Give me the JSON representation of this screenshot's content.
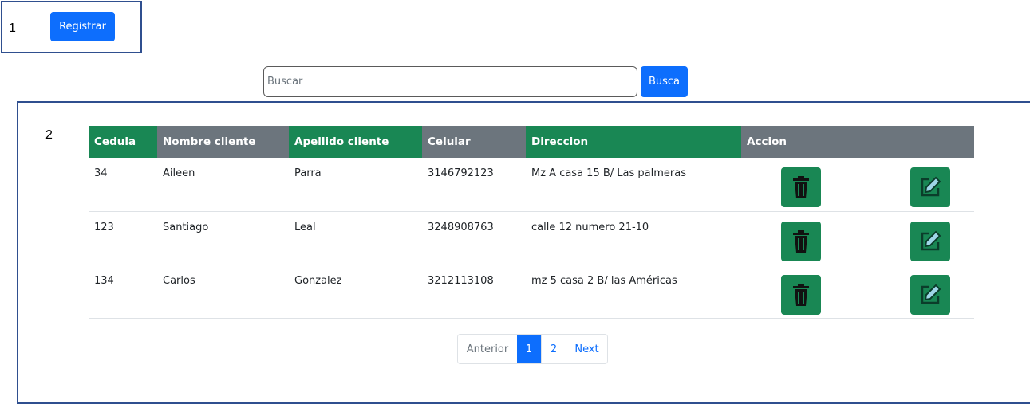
{
  "sections": {
    "one": "1",
    "two": "2"
  },
  "register_button": "Registrar",
  "search": {
    "placeholder": "Buscar",
    "value": "",
    "button": "Busca"
  },
  "table": {
    "headers": [
      "Cedula",
      "Nombre cliente",
      "Apellido cliente",
      "Celular",
      "Direccion",
      "Accion"
    ],
    "rows": [
      {
        "cedula": "34",
        "nombre": "Aileen",
        "apellido": "Parra",
        "celular": "3146792123",
        "direccion": "Mz A casa 15 B/ Las palmeras"
      },
      {
        "cedula": "123",
        "nombre": "Santiago",
        "apellido": "Leal",
        "celular": "3248908763",
        "direccion": "calle 12 numero 21-10"
      },
      {
        "cedula": "134",
        "nombre": "Carlos",
        "apellido": "Gonzalez",
        "celular": "3212113108",
        "direccion": "mz 5 casa 2 B/ las Américas"
      }
    ]
  },
  "pagination": {
    "prev": "Anterior",
    "pages": [
      "1",
      "2"
    ],
    "next": "Next"
  },
  "icons": {
    "delete": "trash-icon",
    "edit": "pencil-square-icon"
  },
  "colors": {
    "primary": "#0d6efd",
    "success": "#198754",
    "secondary": "#6c757d",
    "frame": "#2f4f8f"
  }
}
